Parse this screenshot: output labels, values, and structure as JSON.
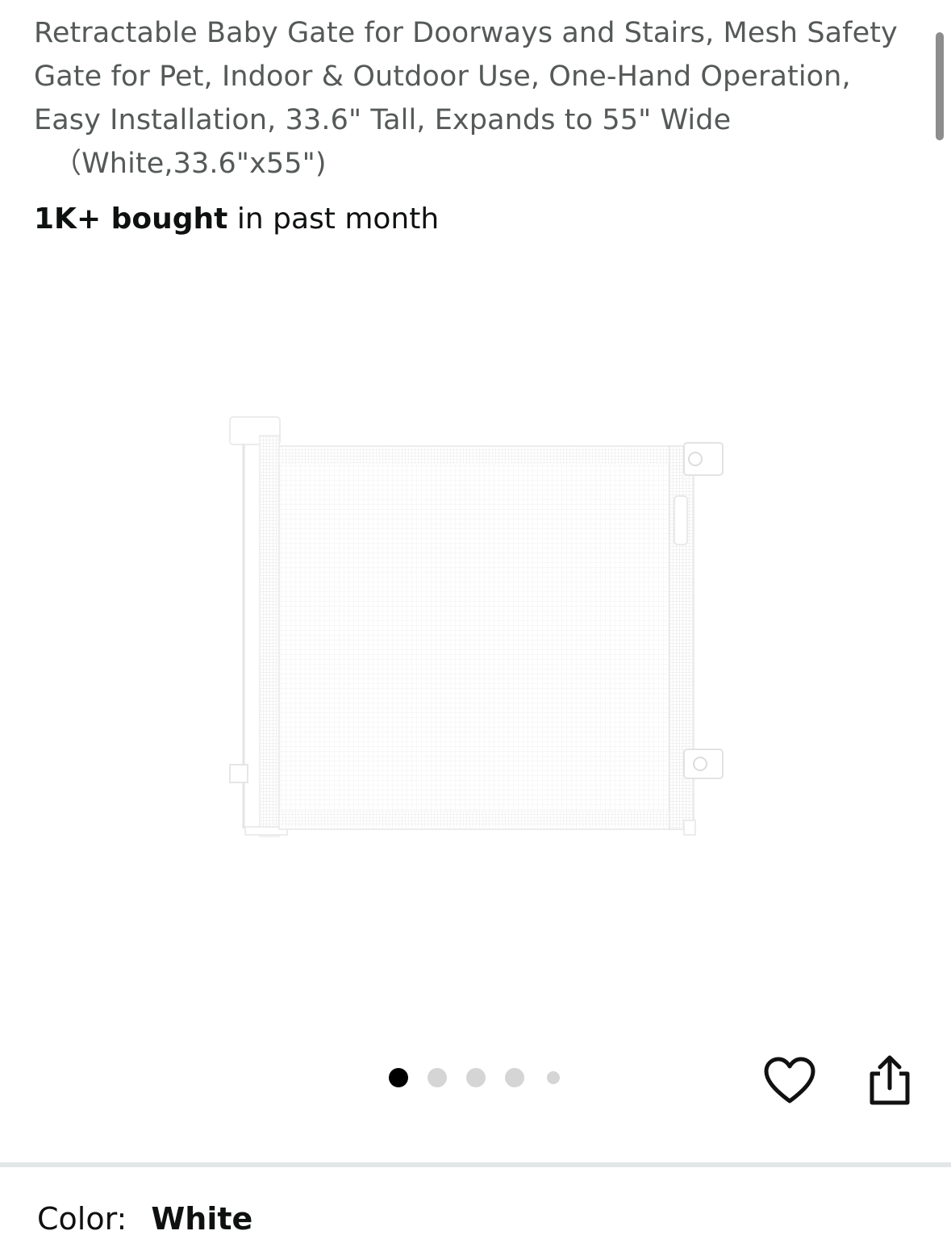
{
  "product": {
    "title_lines": [
      "Retractable Baby Gate for Doorways and Stairs, Mesh Safety",
      "Gate for Pet, Indoor & Outdoor Use, One-Hand Operation,",
      "Easy Installation, 33.6\" Tall, Expands to 55\" Wide"
    ],
    "title_variant": "（White,33.6\"x55\")",
    "bought_count": "1K+ bought",
    "bought_suffix": " in past month",
    "image_alt": "retractable-mesh-baby-gate-white"
  },
  "carousel": {
    "total_indicators": 5,
    "active_index": 0
  },
  "actions": {
    "favorite_icon": "heart-icon",
    "share_icon": "share-icon"
  },
  "color": {
    "label": "Color:",
    "value": "White"
  },
  "colors": {
    "title_text": "#565959",
    "body_text": "#0f1111",
    "dot_active": "#000000",
    "dot_inactive": "#d5d5d5",
    "divider": "#e3e6e6"
  }
}
